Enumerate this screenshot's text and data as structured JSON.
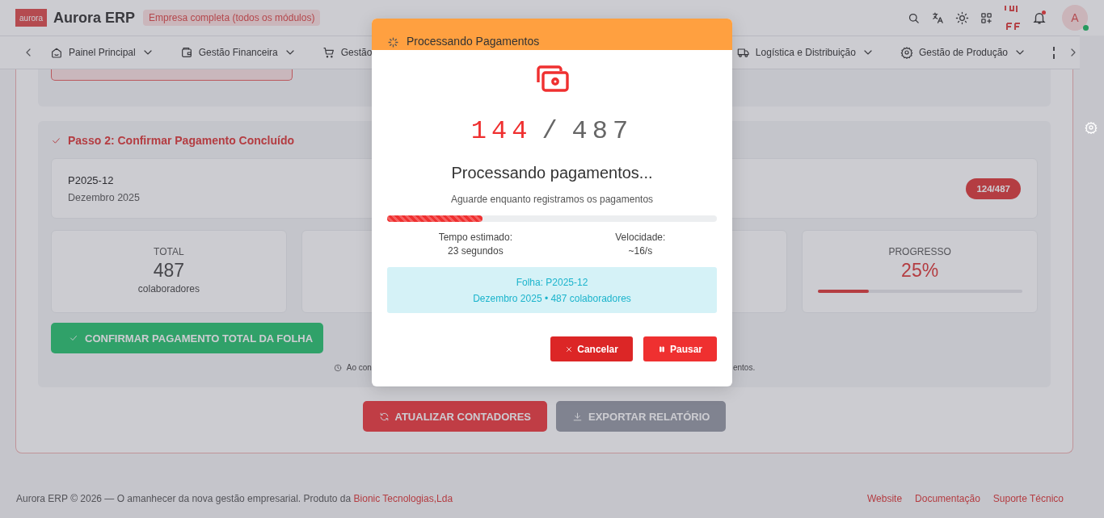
{
  "header": {
    "logo": "aurora",
    "title": "Aurora ERP",
    "badge": "Empresa completa (todos os módulos)",
    "avatar": "A",
    "online": true,
    "notifications": true
  },
  "nav": {
    "items": [
      {
        "label": "Painel Principal",
        "expandable": true
      },
      {
        "label": "Gestão Financeira",
        "expandable": true
      },
      {
        "label": "Gestão",
        "expandable": false
      },
      {
        "label": "Logística e Distribuição",
        "expandable": true
      },
      {
        "label": "Gestão de Produção",
        "expandable": true
      }
    ]
  },
  "step": {
    "title": "Passo 2: Confirmar Pagamento Concluído",
    "period_code": "P2025-12",
    "period_name": "Dezembro 2025",
    "count_badge": "124/487",
    "stats": [
      {
        "kind": "count",
        "label": "TOTAL",
        "value": "487",
        "unit": "colaboradores"
      },
      {
        "kind": "covered"
      },
      {
        "kind": "covered"
      },
      {
        "kind": "progress",
        "label": "PROGRESSO",
        "value": "25%",
        "level": 0.25
      }
    ],
    "confirm_button": "CONFIRMAR PAGAMENTO TOTAL DA FOLHA",
    "note_start": "Ao con",
    "note_end": "entos."
  },
  "actions": [
    {
      "label": "ATUALIZAR CONTADORES",
      "kind": "refresh"
    },
    {
      "label": "EXPORTAR RELATÓRIO",
      "kind": "export"
    }
  ],
  "footer": {
    "text": "Aurora ERP © 2026 — O amanhecer da nova gestão empresarial. Produto da ",
    "company": "Bionic Tecnologias,Lda",
    "links": [
      "Website",
      "Documentação",
      "Suporte Técnico"
    ]
  },
  "modal": {
    "title": "Processando Pagamentos",
    "done": "144",
    "separator": "/",
    "total": "487",
    "heading": "Processando pagamentos...",
    "subtitle": "Aguarde enquanto registramos os pagamentos",
    "level": 0.29,
    "eta_label": "Tempo estimado:",
    "eta_value": "23 segundos",
    "speed_label": "Velocidade:",
    "speed_value": "~16/s",
    "info_line1": "Folha: P2025-12",
    "info_line2": "Dezembro 2025 • 487 colaboradores",
    "buttons": [
      {
        "label": "Cancelar",
        "kind": "cancel"
      },
      {
        "label": "Pausar",
        "kind": "pause"
      }
    ]
  }
}
